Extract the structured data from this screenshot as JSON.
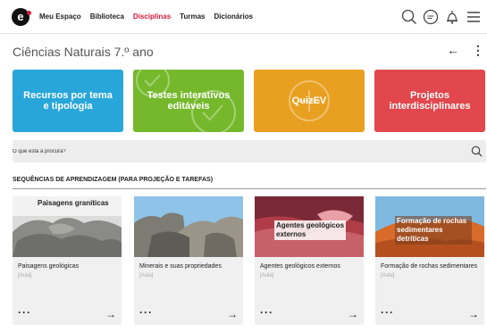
{
  "header": {
    "logo_letter": "e",
    "nav": [
      "Meu Espaço",
      "Biblioteca",
      "Disciplinas",
      "Turmas",
      "Dicionários"
    ],
    "active_nav": "Disciplinas",
    "icons": [
      "search-icon",
      "chat-icon",
      "bell-icon",
      "menu-icon"
    ]
  },
  "page": {
    "title": "Ciências Naturais 7.º ano",
    "back": "←",
    "more": "⋮"
  },
  "tiles": [
    {
      "label": "Recursos por tema e tipologia",
      "color": "#29a6d9"
    },
    {
      "label": "Testes interativos editáveis",
      "color": "#75b82c"
    },
    {
      "label": "QuizEV",
      "color": "#e8a020"
    },
    {
      "label": "Projetos interdisciplinares",
      "color": "#e1474c"
    }
  ],
  "search": {
    "placeholder": "O que está à procura?"
  },
  "section": {
    "title": "SEQUÊNCIAS DE APRENDIZAGEM (PARA PROJEÇÃO E TAREFAS)"
  },
  "cards": [
    {
      "title": "Paisagens geológicas",
      "type": "[Aula]",
      "overlay": "Paisagens graníticas",
      "dots": "···",
      "arrow": "→"
    },
    {
      "title": "Minerais e suas propriedades",
      "type": "[Aula]",
      "overlay": "",
      "dots": "···",
      "arrow": "→"
    },
    {
      "title": "Agentes geológicos externos",
      "type": "[Aula]",
      "overlay": "Agentes geológicos externos",
      "dots": "···",
      "arrow": "→"
    },
    {
      "title": "Formação de rochas sedimentares",
      "type": "[Aula]",
      "overlay": "Formação de rochas sedimentares detríticas",
      "dots": "···",
      "arrow": "→"
    }
  ]
}
